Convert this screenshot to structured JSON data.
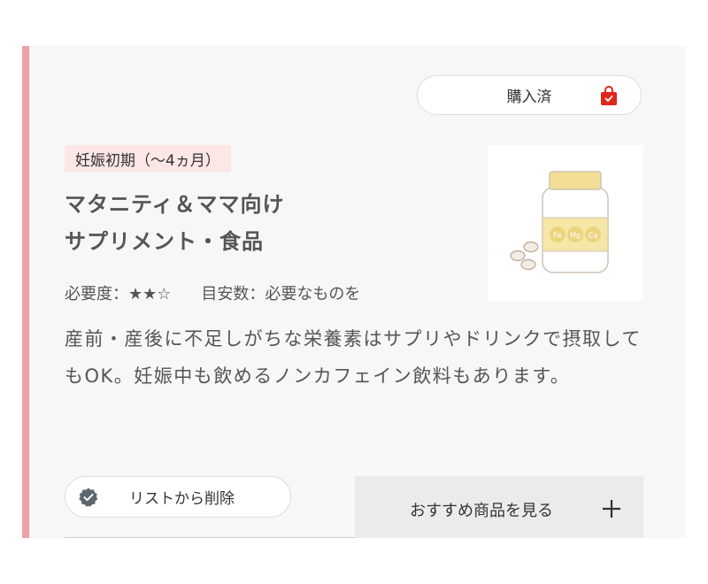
{
  "card": {
    "purchased_label": "購入済",
    "period_badge": "妊娠初期（〜4ヵ月）",
    "title_line1": "マタニティ＆ママ向け",
    "title_line2": "サプリメント・食品",
    "necessity_label": "必要度：",
    "necessity_stars": "★★☆",
    "count_label": "目安数：必要なものを",
    "description": "産前・産後に不足しがちな栄養素はサプリやドリンクで摂取してもOK。妊娠中も飲めるノンカフェイン飲料もあります。",
    "remove_label": "リストから削除",
    "recommend_label": "おすすめ商品を見る",
    "image_labels": [
      "Fe",
      "Mg",
      "Ca"
    ]
  },
  "colors": {
    "accent": "#f0a0a8",
    "badge_bg": "#fde6e6",
    "bag_red": "#e0261a",
    "bottle_cap": "#f2df95",
    "recommend_bg": "#e9ebed"
  },
  "icons": [
    "shopping-bag-check-icon",
    "check-badge-icon",
    "plus-icon"
  ]
}
